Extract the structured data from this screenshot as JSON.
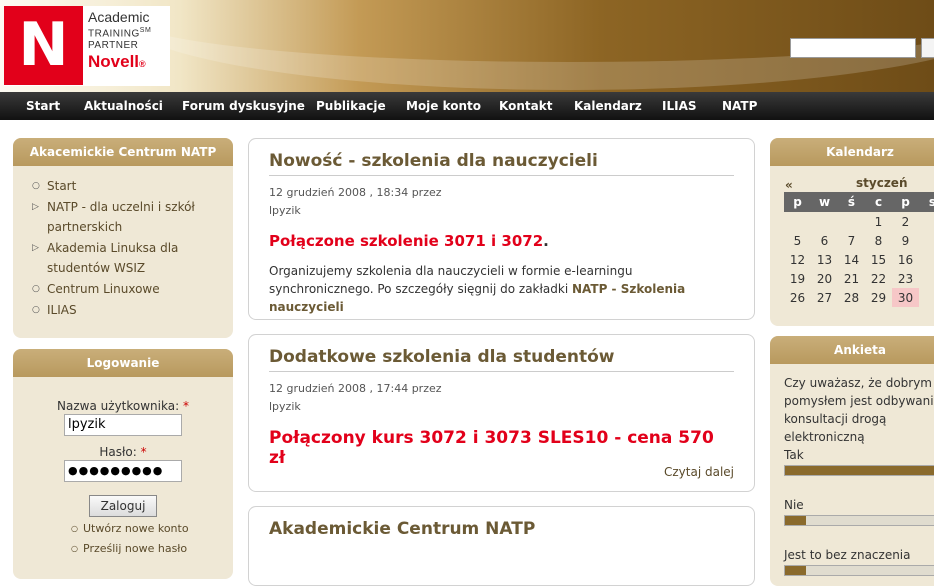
{
  "header": {
    "logo": {
      "l1": "Academic",
      "l2": "TRAINING",
      "l2_sup": "SM",
      "l3": "PARTNER",
      "l4": "Novell",
      "l4_reg": "®",
      "letter": "N"
    },
    "search": {
      "value": "",
      "button_label": ""
    }
  },
  "nav": {
    "items": [
      "Start",
      "Aktualności",
      "Forum dyskusyjne",
      "Publikacje",
      "Moje konto",
      "Kontakt",
      "Kalendarz",
      "ILIAS",
      "NATP"
    ]
  },
  "left": {
    "menu_block": {
      "title": "Akacemickie Centrum NATP",
      "items": [
        {
          "label": "Start",
          "bullet": "circle"
        },
        {
          "label": "NATP - dla uczelni i szkół partnerskich",
          "bullet": "triangle"
        },
        {
          "label": "Akademia Linuksa dla studentów WSIZ",
          "bullet": "triangle"
        },
        {
          "label": "Centrum Linuxowe",
          "bullet": "circle"
        },
        {
          "label": "ILIAS",
          "bullet": "circle"
        }
      ]
    },
    "login": {
      "title": "Logowanie",
      "username_label": "Nazwa użytkownika:",
      "username_value": "lpyzik",
      "password_label": "Hasło:",
      "password_value": "●●●●●●●●●",
      "required_mark": "*",
      "submit": "Zaloguj",
      "links": [
        "Utwórz nowe konto",
        "Prześlij nowe hasło"
      ]
    }
  },
  "main": {
    "nodes": [
      {
        "title": "Nowość - szkolenia dla nauczycieli",
        "date": "12 grudzień 2008 , 18:34 przez",
        "author": "lpyzik",
        "headline": "Połączone szkolenie 3071 i 3072",
        "headline_suffix": ".",
        "body": "Organizujemy szkolenia dla nauczycieli w formie e-learningu synchronicznego. Po szczegóły sięgnij do zakładki ",
        "body_link": "NATP - Szkolenia nauczycieli"
      },
      {
        "title": "Dodatkowe szkolenia dla studentów",
        "date": "12 grudzień 2008 , 17:44 przez",
        "author": "lpyzik",
        "headline": "Połączony kurs 3072 i 3073 SLES10 - cena 570 zł",
        "readmore": "Czytaj dalej"
      },
      {
        "title": "Akademickie Centrum NATP"
      }
    ]
  },
  "right": {
    "calendar": {
      "title": "Kalendarz",
      "prev": "«",
      "month": "styczeń",
      "weekdays": [
        "p",
        "w",
        "ś",
        "c",
        "p",
        "s"
      ],
      "weeks": [
        [
          "",
          "",
          "",
          "1",
          "2",
          ""
        ],
        [
          "5",
          "6",
          "7",
          "8",
          "9",
          ""
        ],
        [
          "12",
          "13",
          "14",
          "15",
          "16",
          ""
        ],
        [
          "19",
          "20",
          "21",
          "22",
          "23",
          ""
        ],
        [
          "26",
          "27",
          "28",
          "29",
          "30",
          ""
        ]
      ],
      "today": "30"
    },
    "poll": {
      "title": "Ankieta",
      "question": "Czy uważasz, że dobrym pomysłem jest odbywanie konsultacji drogą elektroniczną",
      "options": [
        {
          "label": "Tak",
          "fraction": 1.0
        },
        {
          "label": "Nie",
          "fraction": 0.13
        },
        {
          "label": "Jest to bez znaczenia",
          "fraction": 0.13
        }
      ]
    }
  }
}
